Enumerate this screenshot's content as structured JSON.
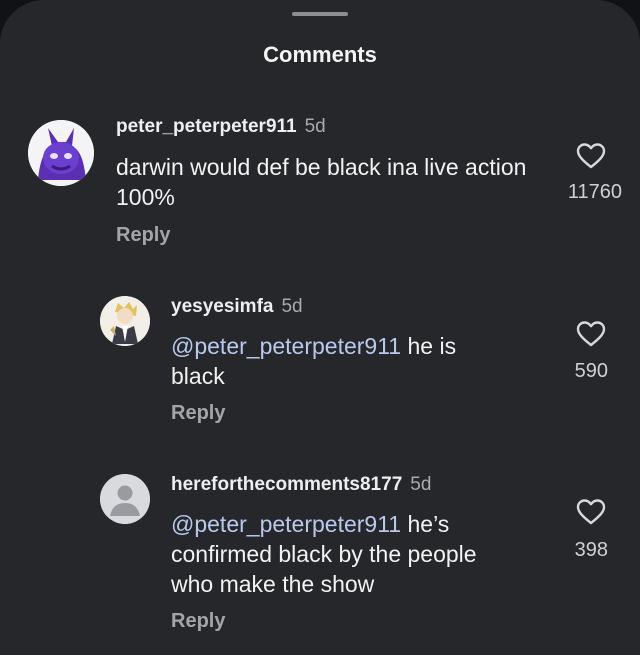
{
  "header": {
    "title": "Comments"
  },
  "comments": [
    {
      "username": "peter_peterpeter911",
      "time": "5d",
      "text": "darwin would def be black ina live action 100%",
      "reply_label": "Reply",
      "likes": "11760",
      "avatar_icon": "purple-character-avatar"
    },
    {
      "username": "yesyesimfa",
      "time": "5d",
      "mention": "@peter_peterpeter911",
      "text": " he is black",
      "reply_label": "Reply",
      "likes": "590",
      "avatar_icon": "anime-character-avatar"
    },
    {
      "username": "hereforthecomments8177",
      "time": "5d",
      "mention": "@peter_peterpeter911",
      "text": " he’s confirmed black by the people who make the show",
      "reply_label": "Reply",
      "likes": "398",
      "avatar_icon": "default-user-avatar"
    }
  ],
  "colors": {
    "sheet_bg": "#26272b",
    "mention": "#b9c9ee",
    "secondary_text": "#a9aaae"
  }
}
